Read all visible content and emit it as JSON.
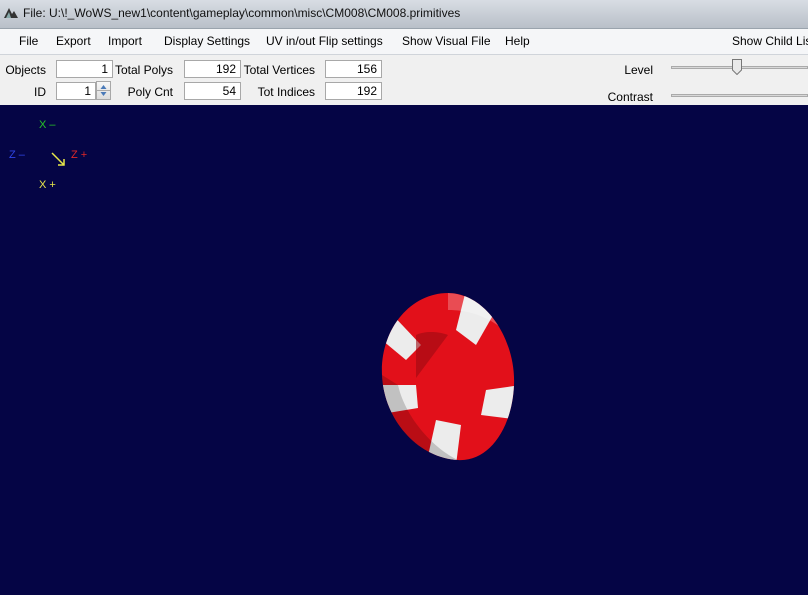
{
  "window": {
    "title": "File: U:\\!_WoWS_new1\\content\\gameplay\\common\\misc\\CM008\\CM008.primitives"
  },
  "menu": {
    "file": "File",
    "export": "Export",
    "import": "Import",
    "display_settings": "Display Settings",
    "uv_flip": "UV in/out Flip settings",
    "show_visual_file": "Show Visual File",
    "help": "Help",
    "show_child_list": "Show Child Lis"
  },
  "stats": {
    "objects_label": "Objects",
    "objects_value": "1",
    "id_label": "ID",
    "id_value": "1",
    "total_polys_label": "Total Polys",
    "total_polys_value": "192",
    "poly_cnt_label": "Poly Cnt",
    "poly_cnt_value": "54",
    "total_vertices_label": "Total Vertices",
    "total_vertices_value": "156",
    "tot_indices_label": "Tot Indices",
    "tot_indices_value": "192"
  },
  "sliders": {
    "level_label": "Level",
    "level_value": 0.48,
    "contrast_label": "Contrast"
  },
  "axes": {
    "x_minus": "X  –",
    "z_minus": "Z  –",
    "z_plus": "Z  +",
    "x_plus": "X  +"
  },
  "colors": {
    "viewport_bg": "#050545",
    "x_top": "#27c427",
    "z_minus": "#2f45e8",
    "z_plus": "#e02828",
    "x_bottom": "#e8e84a",
    "ring_red": "#e2101a",
    "ring_white": "#ececec"
  }
}
